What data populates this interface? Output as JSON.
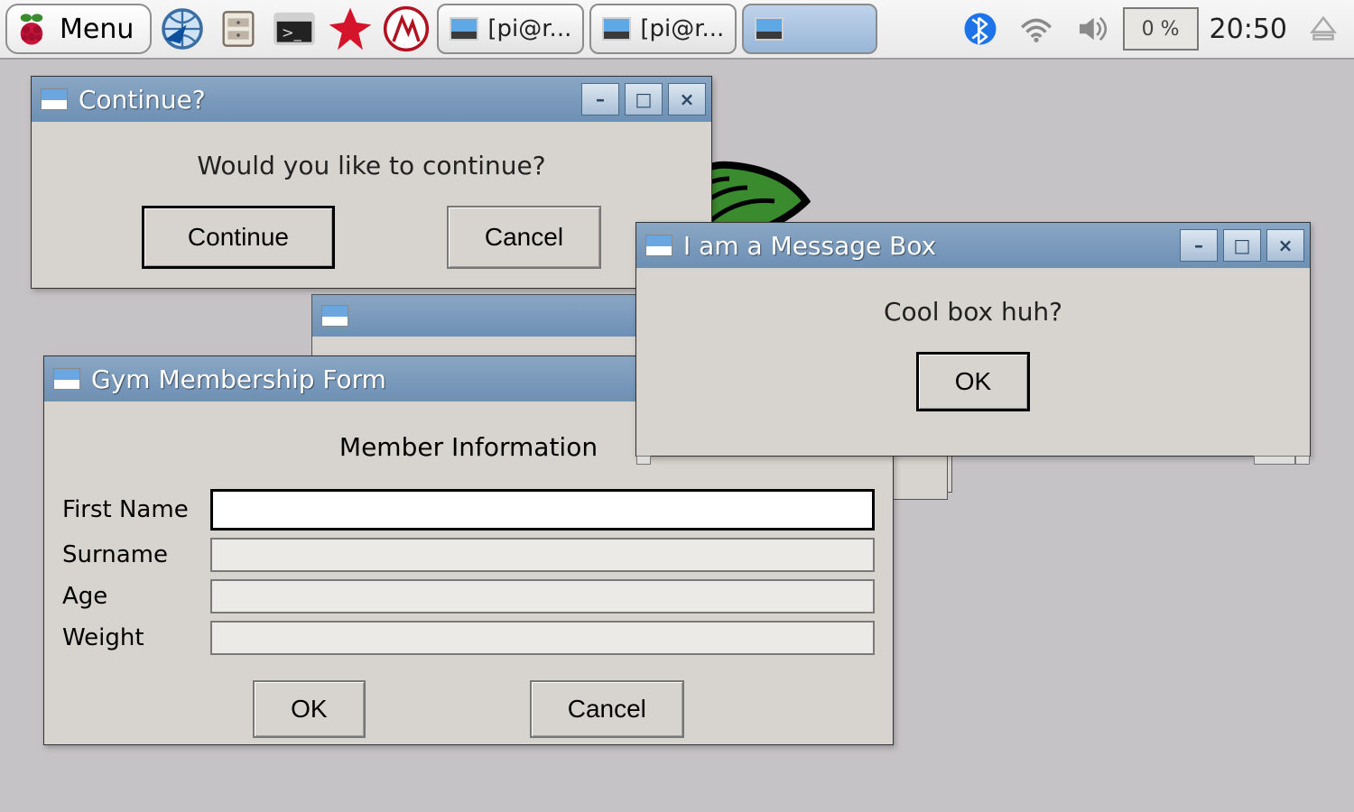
{
  "taskbar": {
    "menu_label": "Menu",
    "tasks": [
      {
        "label": "[pi@r..."
      },
      {
        "label": "[pi@r..."
      },
      {
        "label": ""
      }
    ],
    "cpu": "0 %",
    "clock": "20:50"
  },
  "dialog_continue": {
    "title": "Continue?",
    "message": "Would you like to continue?",
    "btn_continue": "Continue",
    "btn_cancel": "Cancel"
  },
  "dialog_msgbox": {
    "title": "I am a Message Box",
    "message": "Cool box huh?",
    "btn_ok": "OK"
  },
  "dialog_form": {
    "title": "Gym Membership Form",
    "heading": "Member Information",
    "fields": {
      "first_name": {
        "label": "First Name",
        "value": ""
      },
      "surname": {
        "label": "Surname",
        "value": ""
      },
      "age": {
        "label": "Age",
        "value": ""
      },
      "weight": {
        "label": "Weight",
        "value": ""
      }
    },
    "btn_ok": "OK",
    "btn_cancel": "Cancel"
  }
}
